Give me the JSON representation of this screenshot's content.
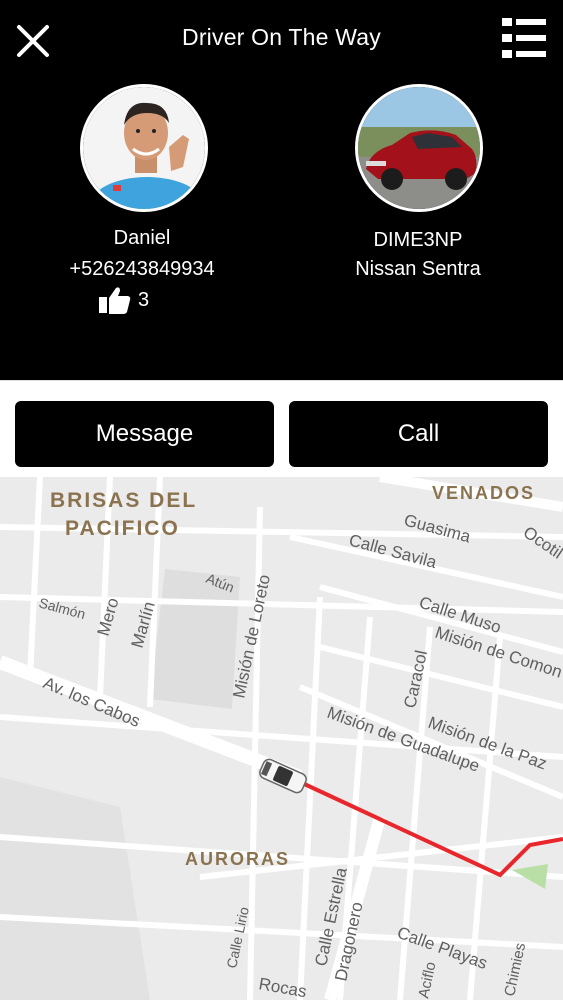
{
  "header": {
    "title": "Driver On The Way",
    "close_icon": "close-icon",
    "menu_icon": "list-menu-icon"
  },
  "driver": {
    "name": "Daniel",
    "phone": "+526243849934",
    "rating_icon": "thumbs-up-icon",
    "rating": "3"
  },
  "vehicle": {
    "plate": "DIME3NP",
    "model": "Nissan Sentra"
  },
  "actions": {
    "message_label": "Message",
    "call_label": "Call"
  },
  "map": {
    "neighborhoods": [
      "BRISAS DEL",
      "PACIFICO",
      "VENADOS",
      "AURORAS"
    ],
    "streets": [
      "Guasima",
      "Ocotil",
      "Calle Savila",
      "Atún",
      "Salmón",
      "Mero",
      "Marlín",
      "Misión de Loreto",
      "Calle Muso",
      "Misión de Comon",
      "Av. los Cabos",
      "Caracol",
      "Misión de la Paz",
      "Misión de Guadalupe",
      "Calle Lirio",
      "Calle Estrella",
      "Dragonero",
      "Calle Playas",
      "Rocas",
      "Aciflo",
      "Chimies"
    ],
    "route_color": "#e8262c",
    "vehicle_icon": "car-marker-icon"
  },
  "colors": {
    "header_bg": "#000000",
    "button_bg": "#000000",
    "map_bg": "#ebebeb"
  }
}
